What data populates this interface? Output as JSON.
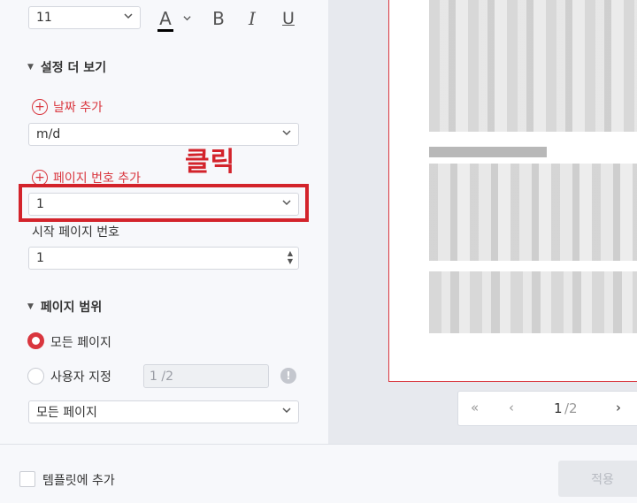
{
  "font": {
    "size_value": "11"
  },
  "format_toolbar": {
    "font_color_icon": "A",
    "bold_icon": "B",
    "italic_icon": "I",
    "underline_icon": "U"
  },
  "more_settings": {
    "title": "설정 더 보기",
    "add_date_label": "날짜 추가",
    "date_format_value": "m/d",
    "add_page_number_label": "페이지 번호 추가",
    "page_number_format_value": "1",
    "start_page_label": "시작 페이지 번호",
    "start_page_value": "1"
  },
  "annotation": {
    "click_label": "클릭"
  },
  "page_range": {
    "title": "페이지 범위",
    "all_pages_label": "모든 페이지",
    "custom_label": "사용자 지정",
    "custom_placeholder": "1 /2",
    "subset_value": "모든 페이지"
  },
  "pager": {
    "current_page": "1",
    "total_pages": "/2"
  },
  "footer": {
    "add_template_label": "템플릿에 추가",
    "apply_label": "적용"
  },
  "colors": {
    "accent": "#d9363e",
    "highlight": "#d3232b"
  }
}
